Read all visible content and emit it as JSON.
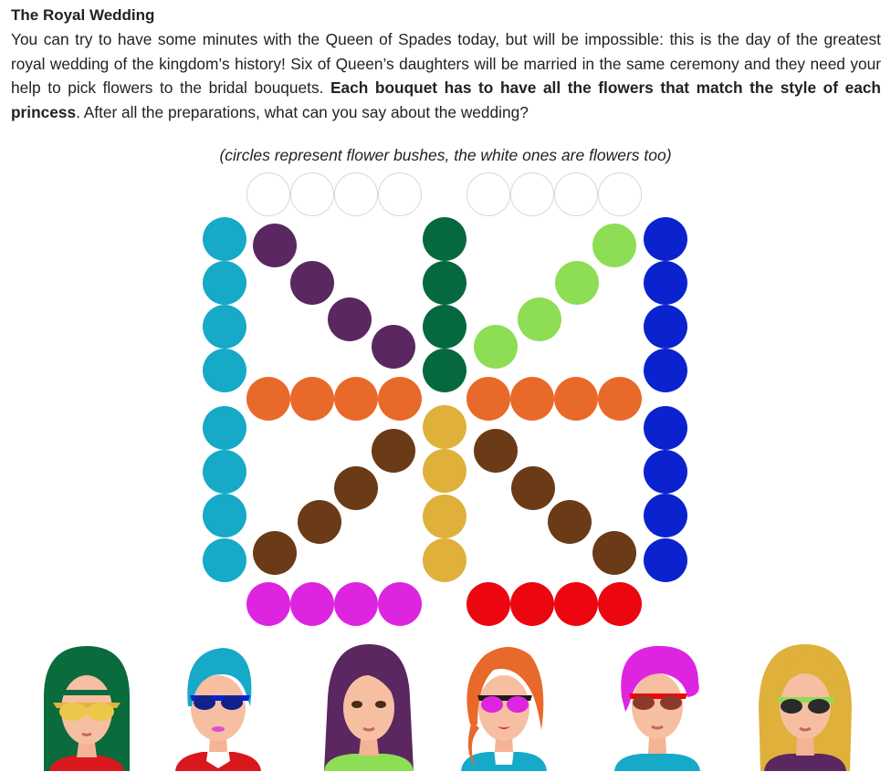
{
  "puzzle": {
    "title": "The Royal Wedding",
    "intro_1": "You can try to have some minutes with the Queen of Spades today, but will be impossible: this is the day of the greatest royal wedding of the kingdom’s history! Six of Queen’s daughters will be married in the same ceremony and they need your help to pick flowers to the bridal bouquets.",
    "intro_bold": "Each bouquet has to have all the flowers that match the style of each princess",
    "intro_2": ". After all the preparations, what can you say about the wedding?",
    "caption": "(circles represent flower bushes, the white ones are flowers too)"
  },
  "colors": {
    "white": "#ffffff",
    "teal": "#16a9c8",
    "purple": "#5a2760",
    "dark_green": "#05683f",
    "light_green": "#8ddd55",
    "blue": "#0a23cf",
    "orange": "#e8692a",
    "brown": "#6b3a17",
    "mustard": "#dfb03a",
    "magenta": "#dd25e0",
    "red": "#ec0610"
  },
  "bush_groups": [
    {
      "color": "white",
      "count": 4
    },
    {
      "color": "white",
      "count": 4
    },
    {
      "color": "teal",
      "count": 8
    },
    {
      "color": "purple",
      "count": 4
    },
    {
      "color": "dark_green",
      "count": 4
    },
    {
      "color": "light_green",
      "count": 4
    },
    {
      "color": "blue",
      "count": 8
    },
    {
      "color": "orange",
      "count": 8
    },
    {
      "color": "brown",
      "count": 8
    },
    {
      "color": "mustard",
      "count": 4
    },
    {
      "color": "magenta",
      "count": 4
    },
    {
      "color": "red",
      "count": 4
    }
  ],
  "princesses": [
    {
      "hair": "dark green",
      "glasses": "yellow",
      "shirt": "red"
    },
    {
      "hair": "teal",
      "glasses": "blue",
      "shirt": "red"
    },
    {
      "hair": "purple",
      "glasses": "none",
      "shirt": "light green"
    },
    {
      "hair": "orange",
      "glasses": "magenta",
      "shirt": "teal"
    },
    {
      "hair": "magenta",
      "glasses": "red",
      "shirt": "teal"
    },
    {
      "hair": "mustard",
      "glasses": "light green",
      "shirt": "purple"
    }
  ]
}
